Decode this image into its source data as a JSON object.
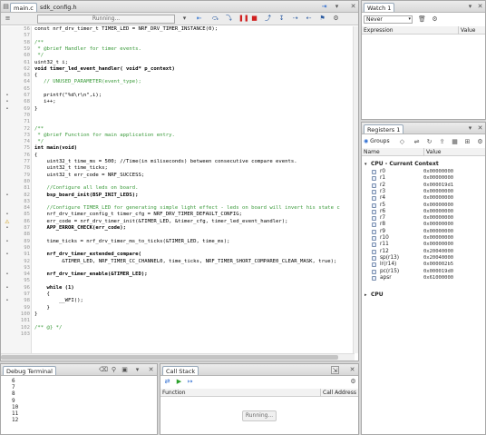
{
  "editor": {
    "tabs": [
      {
        "label": "main.c"
      },
      {
        "label": "sdk_config.h"
      }
    ],
    "status": "Running...",
    "lines": [
      {
        "n": "56",
        "t": "const nrf_drv_timer_t TIMER_LED = NRF_DRV_TIMER_INSTANCE(0);",
        "s": "",
        "m": ""
      },
      {
        "n": "57",
        "t": "",
        "s": "",
        "m": ""
      },
      {
        "n": "58",
        "t": "/**",
        "s": "cm",
        "m": ""
      },
      {
        "n": "59",
        "t": " * @brief Handler for timer events.",
        "s": "cm",
        "m": ""
      },
      {
        "n": "60",
        "t": " */",
        "s": "cm",
        "m": ""
      },
      {
        "n": "61",
        "t": "uint32_t i;",
        "s": "",
        "m": ""
      },
      {
        "n": "62",
        "t": "void timer_led_event_handler( void* p_context)",
        "s": "bold",
        "m": ""
      },
      {
        "n": "63",
        "t": "{",
        "s": "",
        "m": ""
      },
      {
        "n": "64",
        "t": "   // UNUSED_PARAMETER(event_type);",
        "s": "cm",
        "m": ""
      },
      {
        "n": "65",
        "t": "",
        "s": "",
        "m": ""
      },
      {
        "n": "67",
        "t": "   printf(\"%d\\r\\n\",i);",
        "s": "",
        "m": "dot"
      },
      {
        "n": "68",
        "t": "   i++;",
        "s": "",
        "m": "dot"
      },
      {
        "n": "69",
        "t": "}",
        "s": "",
        "m": "dot"
      },
      {
        "n": "70",
        "t": "",
        "s": "",
        "m": ""
      },
      {
        "n": "71",
        "t": "",
        "s": "",
        "m": ""
      },
      {
        "n": "72",
        "t": "/**",
        "s": "cm",
        "m": ""
      },
      {
        "n": "73",
        "t": " * @brief Function for main application entry.",
        "s": "cm",
        "m": ""
      },
      {
        "n": "74",
        "t": " */",
        "s": "cm",
        "m": ""
      },
      {
        "n": "75",
        "t": "int main(void)",
        "s": "bold",
        "m": ""
      },
      {
        "n": "76",
        "t": "{",
        "s": "",
        "m": ""
      },
      {
        "n": "77",
        "t": "    uint32_t time_ms = 500; //Time(in miliseconds) between consecutive compare events.",
        "s": "",
        "m": ""
      },
      {
        "n": "78",
        "t": "    uint32_t time_ticks;",
        "s": "",
        "m": ""
      },
      {
        "n": "79",
        "t": "    uint32_t err_code = NRF_SUCCESS;",
        "s": "",
        "m": ""
      },
      {
        "n": "80",
        "t": "",
        "s": "",
        "m": ""
      },
      {
        "n": "81",
        "t": "    //Configure all leds on board.",
        "s": "cm",
        "m": ""
      },
      {
        "n": "82",
        "t": "    bsp_board_init(BSP_INIT_LEDS);",
        "s": "bold",
        "m": "dot"
      },
      {
        "n": "83",
        "t": "",
        "s": "",
        "m": ""
      },
      {
        "n": "84",
        "t": "    //Configure TIMER_LED for generating simple light effect - leds on board will invert his state c",
        "s": "cm",
        "m": ""
      },
      {
        "n": "85",
        "t": "    nrf_drv_timer_config_t timer_cfg = NRF_DRV_TIMER_DEFAULT_CONFIG;",
        "s": "",
        "m": "dot"
      },
      {
        "n": "86",
        "t": "    err_code = nrf_drv_timer_init(&TIMER_LED, &timer_cfg, timer_led_event_handler);",
        "s": "",
        "m": "warn"
      },
      {
        "n": "87",
        "t": "    APP_ERROR_CHECK(err_code);",
        "s": "bold",
        "m": "dot"
      },
      {
        "n": "88",
        "t": "",
        "s": "",
        "m": ""
      },
      {
        "n": "89",
        "t": "    time_ticks = nrf_drv_timer_ms_to_ticks(&TIMER_LED, time_ms);",
        "s": "",
        "m": "dot"
      },
      {
        "n": "90",
        "t": "",
        "s": "",
        "m": ""
      },
      {
        "n": "91",
        "t": "    nrf_drv_timer_extended_compare(",
        "s": "bold",
        "m": "dot"
      },
      {
        "n": "92",
        "t": "         &TIMER_LED, NRF_TIMER_CC_CHANNEL0, time_ticks, NRF_TIMER_SHORT_COMPARE0_CLEAR_MASK, true);",
        "s": "",
        "m": ""
      },
      {
        "n": "93",
        "t": "",
        "s": "",
        "m": ""
      },
      {
        "n": "94",
        "t": "    nrf_drv_timer_enable(&TIMER_LED);",
        "s": "bold",
        "m": "dot"
      },
      {
        "n": "95",
        "t": "",
        "s": "",
        "m": ""
      },
      {
        "n": "96",
        "t": "    while (1)",
        "s": "bold",
        "m": "dot"
      },
      {
        "n": "97",
        "t": "    {",
        "s": "",
        "m": ""
      },
      {
        "n": "98",
        "t": "        __WFI();",
        "s": "",
        "m": "dot"
      },
      {
        "n": "99",
        "t": "    }",
        "s": "",
        "m": ""
      },
      {
        "n": "100",
        "t": "}",
        "s": "",
        "m": ""
      },
      {
        "n": "101",
        "t": "",
        "s": "",
        "m": ""
      },
      {
        "n": "102",
        "t": "/** @} */",
        "s": "cm",
        "m": ""
      },
      {
        "n": "103",
        "t": "",
        "s": "",
        "m": ""
      }
    ]
  },
  "watch": {
    "tab": "Watch 1",
    "refresh": "Never",
    "col_expression": "Expression",
    "col_value": "Value"
  },
  "registers": {
    "tab": "Registers 1",
    "groups_label": "Groups",
    "col_name": "Name",
    "col_value": "Value",
    "group_cpu_current": "CPU - Current Context",
    "rows": [
      {
        "name": "r0",
        "value": "0x00000000"
      },
      {
        "name": "r1",
        "value": "0x00000000"
      },
      {
        "name": "r2",
        "value": "0x000019d1"
      },
      {
        "name": "r3",
        "value": "0x00000000"
      },
      {
        "name": "r4",
        "value": "0x00000000"
      },
      {
        "name": "r5",
        "value": "0x00000000"
      },
      {
        "name": "r6",
        "value": "0x00000000"
      },
      {
        "name": "r7",
        "value": "0x00000000"
      },
      {
        "name": "r8",
        "value": "0x00000000"
      },
      {
        "name": "r9",
        "value": "0x00000000"
      },
      {
        "name": "r10",
        "value": "0x00000000"
      },
      {
        "name": "r11",
        "value": "0x00000000"
      },
      {
        "name": "r12",
        "value": "0x20040000"
      },
      {
        "name": "sp(r13)",
        "value": "0x20040000"
      },
      {
        "name": "lr(r14)",
        "value": "0x000002b5"
      },
      {
        "name": "pc(r15)",
        "value": "0x000019d0"
      },
      {
        "name": "apsr",
        "value": "0x61000000"
      }
    ],
    "group_cpu": "CPU"
  },
  "terminal": {
    "tab": "Debug Terminal",
    "lines": [
      "6",
      "7",
      "8",
      "9",
      "10",
      "11",
      "12"
    ]
  },
  "callstack": {
    "tab": "Call Stack",
    "col_function": "Function",
    "col_address": "Call Address",
    "status": "Running..."
  }
}
